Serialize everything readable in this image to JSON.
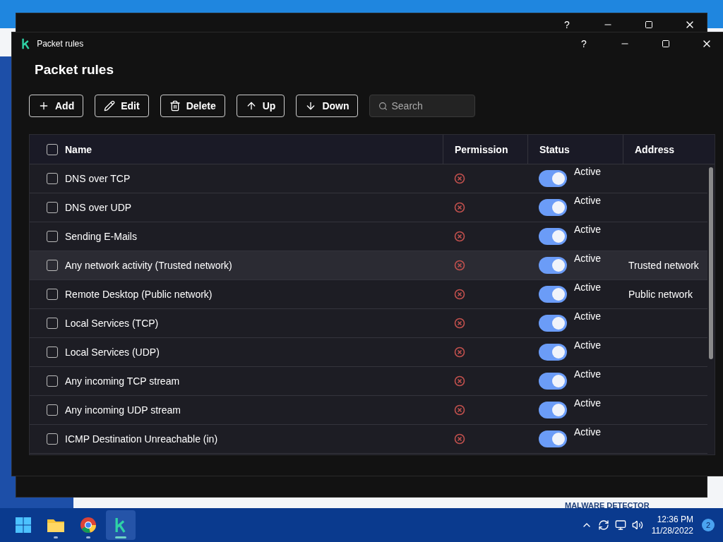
{
  "background_page": {
    "side_link": "MALWARE DETECTOR"
  },
  "back_window": {
    "help": "?"
  },
  "dialog": {
    "app_title": "Packet rules",
    "help": "?",
    "heading": "Packet rules",
    "toolbar": [
      {
        "kind": "add",
        "label": "Add"
      },
      {
        "kind": "edit",
        "label": "Edit"
      },
      {
        "kind": "delete",
        "label": "Delete"
      },
      {
        "kind": "up",
        "label": "Up"
      },
      {
        "kind": "down",
        "label": "Down"
      }
    ],
    "search": {
      "placeholder": "Search"
    },
    "table": {
      "select_all": {
        "checked": false
      },
      "columns": [
        "Name",
        "Permission",
        "Status",
        "Address"
      ],
      "rows": [
        {
          "name": "DNS over TCP",
          "checked": false,
          "blocked": true,
          "active": true,
          "status": "Active",
          "highlighted": false
        },
        {
          "name": "DNS over UDP",
          "checked": false,
          "blocked": true,
          "active": true,
          "status": "Active",
          "highlighted": false
        },
        {
          "name": "Sending E-Mails",
          "checked": false,
          "blocked": true,
          "active": true,
          "status": "Active",
          "highlighted": false
        },
        {
          "name": "Any network activity (Trusted network)",
          "checked": false,
          "blocked": true,
          "active": true,
          "status": "Active",
          "address": "Trusted network",
          "highlighted": true
        },
        {
          "name": "Remote Desktop (Public network)",
          "checked": false,
          "blocked": true,
          "active": true,
          "status": "Active",
          "address": "Public network",
          "highlighted": false
        },
        {
          "name": "Local Services (TCP)",
          "checked": false,
          "blocked": true,
          "active": true,
          "status": "Active",
          "highlighted": false
        },
        {
          "name": "Local Services (UDP)",
          "checked": false,
          "blocked": true,
          "active": true,
          "status": "Active",
          "highlighted": false
        },
        {
          "name": "Any incoming TCP stream",
          "checked": false,
          "blocked": true,
          "active": true,
          "status": "Active",
          "highlighted": false
        },
        {
          "name": "Any incoming UDP stream",
          "checked": false,
          "blocked": true,
          "active": true,
          "status": "Active",
          "highlighted": false
        },
        {
          "name": "ICMP Destination Unreachable (in)",
          "checked": false,
          "blocked": true,
          "active": true,
          "status": "Active",
          "highlighted": false
        }
      ]
    }
  },
  "taskbar": {
    "apps": [
      {
        "kind": "start",
        "running": false,
        "selected": false
      },
      {
        "kind": "files",
        "running": true,
        "selected": false
      },
      {
        "kind": "browser",
        "running": true,
        "selected": false
      },
      {
        "kind": "kaspersky",
        "running": true,
        "selected": true
      }
    ],
    "time": "12:36 PM",
    "date": "11/28/2022",
    "notifications": "2"
  }
}
